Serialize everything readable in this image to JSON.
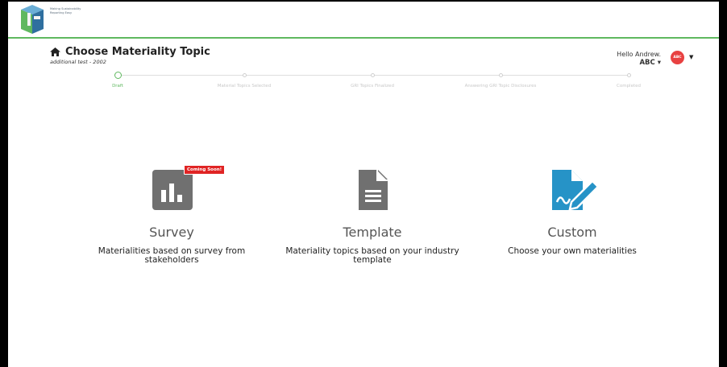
{
  "header": {
    "logo_text": "Making Sustainability Reporting Easy",
    "title": "Choose Materiality Topic",
    "subtitle": "additional test - 2002",
    "home_icon": "home-icon"
  },
  "user": {
    "greeting": "Hello Andrew.",
    "org": "ABC",
    "avatar_text": "ABC"
  },
  "stepper": {
    "steps": [
      {
        "label": "Draft",
        "active": true
      },
      {
        "label": "Material Topics Selected",
        "active": false
      },
      {
        "label": "GRI Topics Finalized",
        "active": false
      },
      {
        "label": "Answering GRI Topic Disclosures",
        "active": false
      },
      {
        "label": "Completed",
        "active": false
      }
    ]
  },
  "cards": [
    {
      "title": "Survey",
      "desc": "Materialities based on survey from stakeholders",
      "icon": "bar-chart-icon",
      "badge": "Coming Soon!"
    },
    {
      "title": "Template",
      "desc": "Materiality topics based on your industry template",
      "icon": "document-icon"
    },
    {
      "title": "Custom",
      "desc": "Choose your own materialities",
      "icon": "edit-document-icon"
    }
  ],
  "colors": {
    "accent": "#5fb85f",
    "badge": "#e02424",
    "survey_icon": "#707070",
    "template_icon": "#707070",
    "custom_icon": "#2693c7"
  }
}
